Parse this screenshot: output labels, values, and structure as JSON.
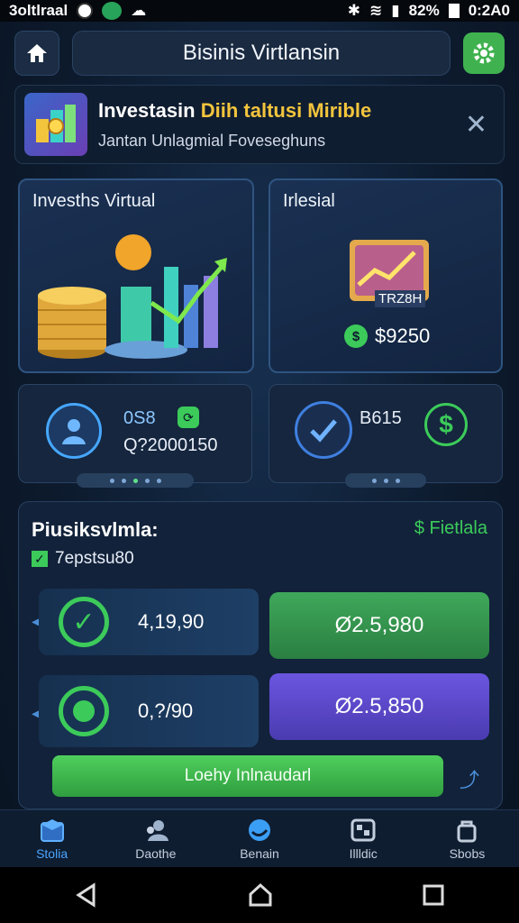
{
  "status_bar": {
    "left_text": "3oltlraal",
    "battery": "82%",
    "time": "0:2A0"
  },
  "header": {
    "title": "Bisinis Virtlansin"
  },
  "banner": {
    "title_white": "Investasin",
    "title_yellow": "Diih taltusi Mirible",
    "subtitle": "Jantan Unlagmial Foveseghuns"
  },
  "cards": {
    "left": {
      "title": "Invesths Virtual"
    },
    "right": {
      "title": "Irlesial",
      "chart_label": "TRZ8H",
      "amount": "$9250"
    }
  },
  "minis": {
    "left": {
      "label": "0S8",
      "value": "Q?2000150"
    },
    "right": {
      "label": "B615"
    }
  },
  "panel": {
    "title": "Piusiksvlmla:",
    "link": "$ Fietlala",
    "checkbox_label": "7epstsu80",
    "rows": [
      {
        "left_value": "4,19,90",
        "right_value": "Ø2.5,980"
      },
      {
        "left_value": "0,?/90",
        "right_value": "Ø2.5,850"
      }
    ],
    "cta": "Loehy Inlnaudarl"
  },
  "nav": [
    {
      "label": "Stolia",
      "icon": "box-icon",
      "active": true
    },
    {
      "label": "Daothe",
      "icon": "people-icon",
      "active": false
    },
    {
      "label": "Benain",
      "icon": "circle-icon",
      "active": false
    },
    {
      "label": "Illldic",
      "icon": "grid-icon",
      "active": false
    },
    {
      "label": "Sbobs",
      "icon": "bag-icon",
      "active": false
    }
  ],
  "colors": {
    "accent_green": "#3fb24f",
    "accent_yellow": "#f3c53d",
    "accent_blue": "#4aa6ff",
    "purple": "#6b4fd6"
  }
}
